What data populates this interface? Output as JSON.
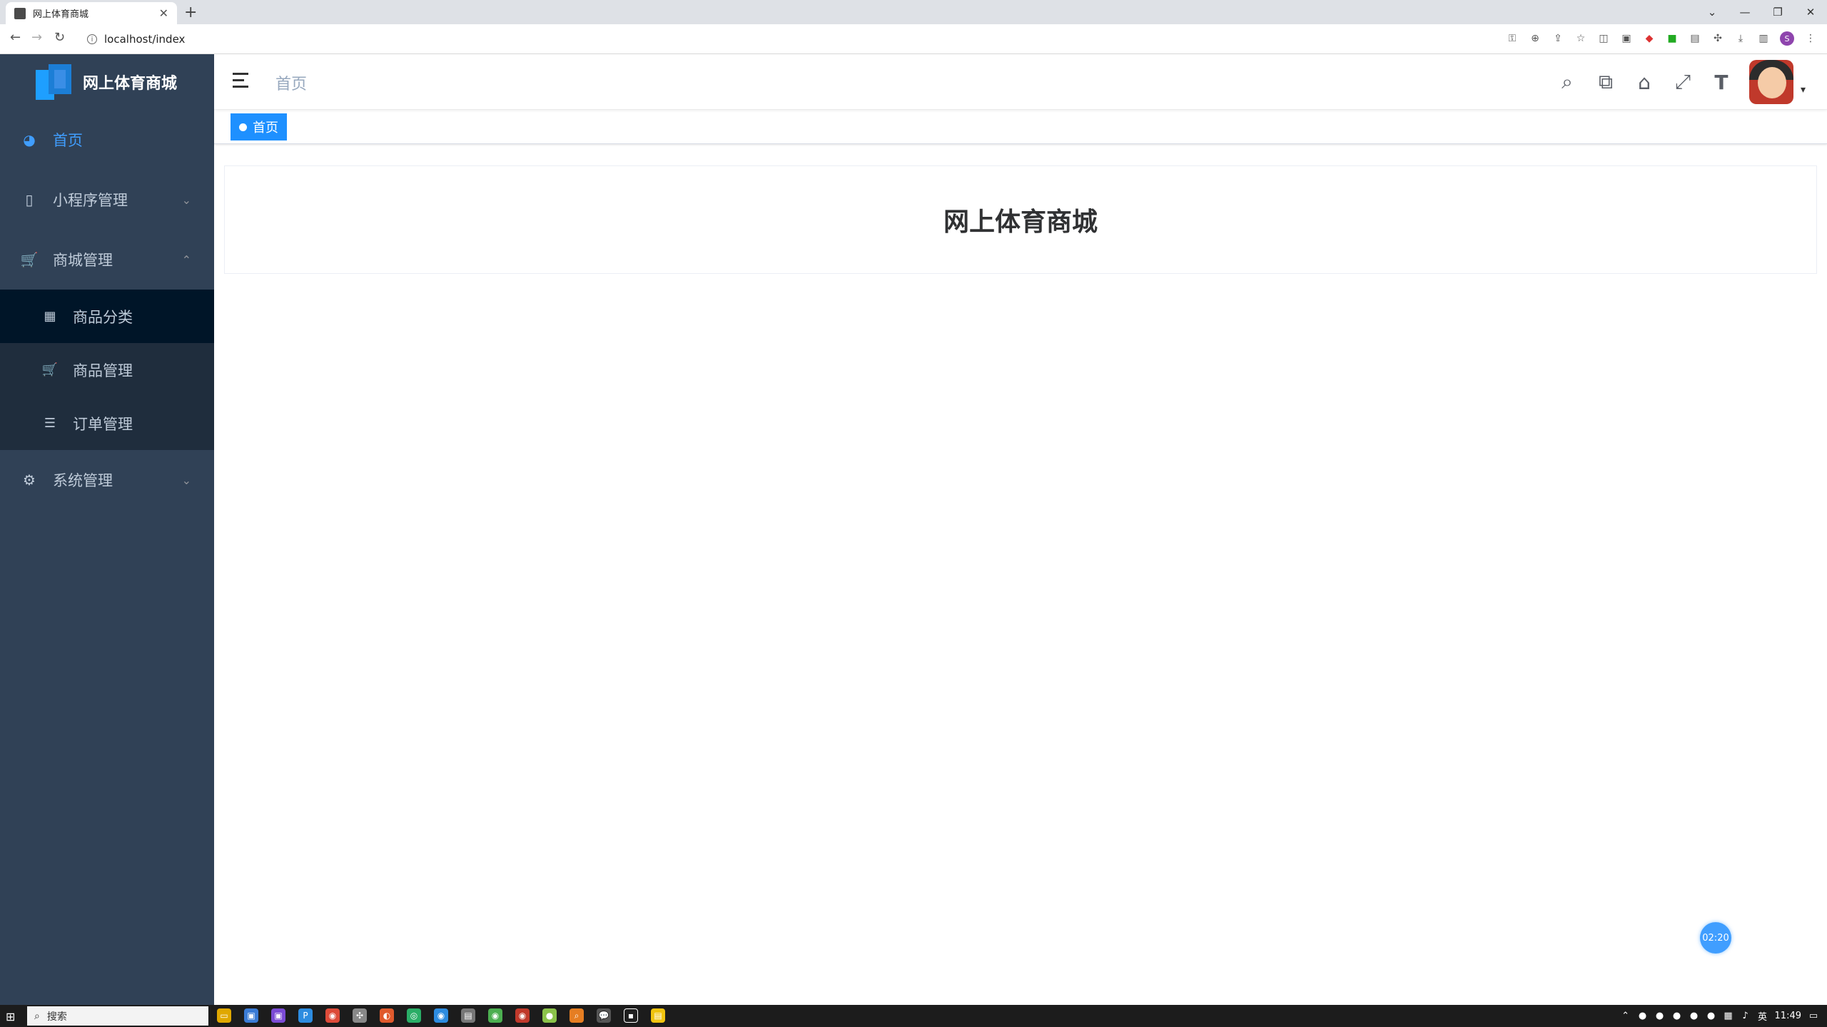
{
  "browser": {
    "tab_title": "网上体育商城",
    "tab_close": "✕",
    "new_tab": "+",
    "url": "localhost/index",
    "window_controls": [
      "⌄",
      "—",
      "❐",
      "✕"
    ],
    "profile_initial": "S"
  },
  "sidebar": {
    "logo_text": "网上体育商城",
    "items": [
      {
        "label": "首页",
        "icon": "dashboard-icon",
        "glyph": "◕",
        "active": true
      },
      {
        "label": "小程序管理",
        "icon": "phone-icon",
        "glyph": "▯",
        "chevron": "⌄"
      },
      {
        "label": "商城管理",
        "icon": "cart-icon",
        "glyph": "🛒",
        "chevron": "⌃",
        "expanded": true,
        "children": [
          {
            "label": "商品分类",
            "icon": "table-icon",
            "glyph": "▦"
          },
          {
            "label": "商品管理",
            "icon": "cart-icon",
            "glyph": "🛒"
          },
          {
            "label": "订单管理",
            "icon": "list-icon",
            "glyph": "☰"
          }
        ]
      },
      {
        "label": "系统管理",
        "icon": "gear-icon",
        "glyph": "⚙",
        "chevron": "⌄"
      }
    ]
  },
  "navbar": {
    "breadcrumb": "首页",
    "tools": [
      {
        "name": "search-icon",
        "glyph": "⌕"
      },
      {
        "name": "chat-icon",
        "glyph": "⧉"
      },
      {
        "name": "home-icon",
        "glyph": "⌂"
      },
      {
        "name": "fullscreen-icon",
        "glyph": "⤢"
      },
      {
        "name": "font-size-icon",
        "glyph": "T"
      }
    ],
    "caret": "▾"
  },
  "tags": [
    {
      "label": "首页"
    }
  ],
  "main": {
    "heading": "网上体育商城"
  },
  "timer": "02:20",
  "taskbar": {
    "search_placeholder": "搜索",
    "clock": "11:49",
    "ime": "英"
  },
  "colors": {
    "sidebar_bg": "#304156",
    "active": "#409eff",
    "tag": "#1e90ff"
  }
}
